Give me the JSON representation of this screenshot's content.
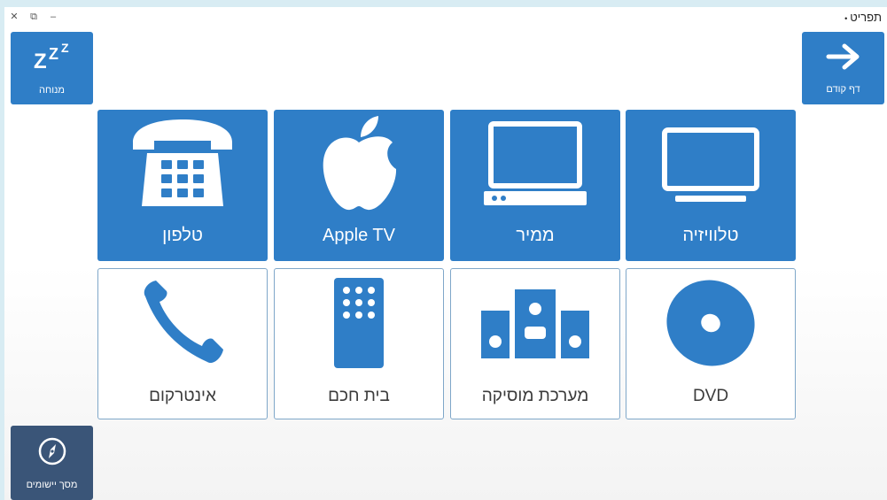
{
  "window": {
    "title": "תפריט",
    "title_dot": "•",
    "controls": {
      "close": "✕",
      "restore": "⧉",
      "minimize": "–"
    }
  },
  "corner_buttons": {
    "rest": {
      "label": "מנוחה",
      "icon": "zzz-icon"
    },
    "previous_page": {
      "label": "דף קודם",
      "icon": "arrow-right-icon"
    },
    "apps_screen": {
      "label": "מסך יישומים",
      "icon": "compass-icon"
    }
  },
  "tiles": {
    "tv": {
      "label": "טלוויזיה",
      "icon": "tv-icon",
      "style": "filled"
    },
    "converter": {
      "label": "ממיר",
      "icon": "set-top-box-icon",
      "style": "filled"
    },
    "apple_tv": {
      "label": "Apple TV",
      "icon": "apple-icon",
      "style": "filled"
    },
    "phone": {
      "label": "טלפון",
      "icon": "desk-phone-icon",
      "style": "filled"
    },
    "dvd": {
      "label": "DVD",
      "icon": "disc-icon",
      "style": "outline"
    },
    "music_system": {
      "label": "מערכת מוסיקה",
      "icon": "speakers-icon",
      "style": "outline"
    },
    "smart_home": {
      "label": "בית חכם",
      "icon": "remote-icon",
      "style": "outline"
    },
    "intercom": {
      "label": "אינטרקום",
      "icon": "handset-icon",
      "style": "outline"
    }
  },
  "colors": {
    "tile_blue": "#2f7ec7",
    "apps_button": "#3a5578",
    "outline_border": "#7fa7c9",
    "background": "#d8ecf3"
  }
}
